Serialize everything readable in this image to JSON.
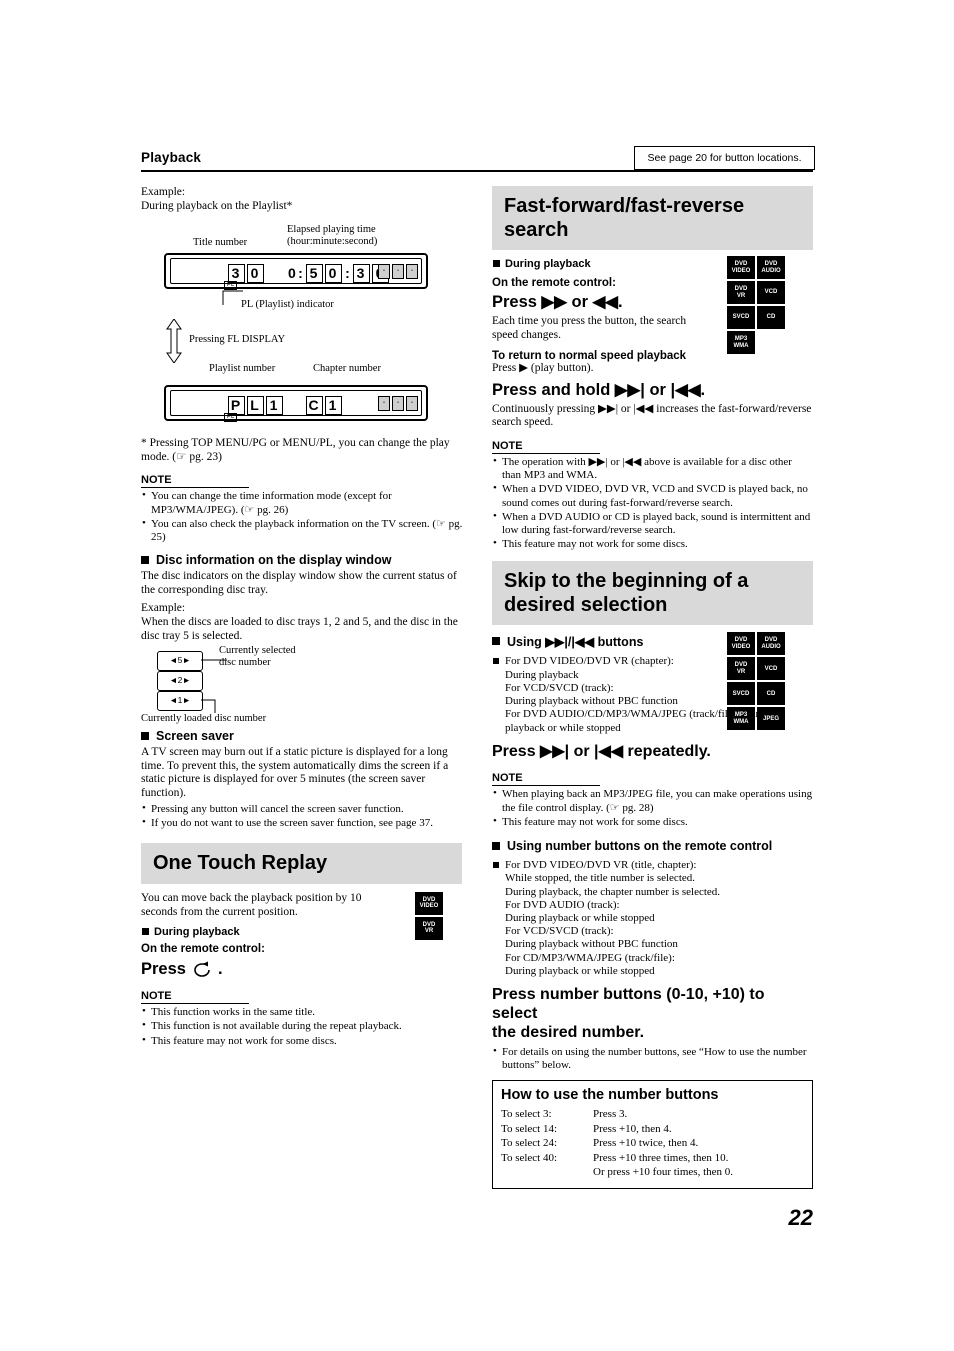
{
  "header": {
    "title": "Playback",
    "note_box": "See page 20 for button locations."
  },
  "left": {
    "example_label": "Example:",
    "example_line": "During playback on the Playlist*",
    "callout_title_number": "Title number",
    "callout_elapsed_1": "Elapsed playing time",
    "callout_elapsed_2": "(hour:minute:second)",
    "display1": {
      "d1": "3",
      "d2": "0",
      "t1": "0",
      "t2": ":",
      "t3": "5",
      "t4": "0",
      "t5": ":",
      "t6": "3",
      "t7": "0",
      "sub": "PL"
    },
    "callout_pl": "PL (Playlist) indicator",
    "callout_pressing": "Pressing FL DISPLAY",
    "callout_playlist_number": "Playlist number",
    "callout_chapter_number": "Chapter number",
    "display2": {
      "p": "P",
      "l": "L",
      "n1": "1",
      "c": "C",
      "n2": "1",
      "sub": "PL"
    },
    "footnote": "*  Pressing TOP MENU/PG or MENU/PL, you can change the play mode. (☞ pg. 23)",
    "note_label": "NOTE",
    "notes": [
      "You can change the time information mode (except for MP3/WMA/JPEG). (☞ pg. 26)",
      "You can also check the playback information on the TV screen. (☞ pg. 25)"
    ],
    "disc_info_heading": "Disc information on the display window",
    "disc_info_body": "The disc indicators on the display window show the current status of the corresponding disc tray.",
    "disc_example_label": "Example:",
    "disc_example_body": "When the discs are loaded to disc trays 1, 2 and 5, and the disc in the disc tray 5 is selected.",
    "tray_items": [
      "5",
      "2",
      "1"
    ],
    "callout_currently_selected_1": "Currently selected",
    "callout_currently_selected_2": "disc number",
    "callout_currently_loaded": "Currently loaded disc number",
    "screen_saver_heading": "Screen saver",
    "screen_saver_body": "A TV screen may burn out if a static picture is displayed for a long time. To prevent this, the system automatically dims the screen if a static picture is displayed for over 5 minutes (the screen saver function).",
    "screen_saver_notes": [
      "Pressing any button will cancel the screen saver function.",
      "If you do not want to use the screen saver function, see page 37."
    ],
    "one_touch_title": "One Touch Replay",
    "one_touch_body": "You can move back the playback position by 10 seconds from the current position.",
    "one_touch_chips": [
      {
        "l1": "DVD",
        "l2": "VIDEO"
      },
      {
        "l1": "DVD",
        "l2": "VR"
      }
    ],
    "during_playback": "During playback",
    "on_remote": "On the remote control:",
    "press_label": "Press",
    "press_icon": "replay-10-icon",
    "one_touch_note_label": "NOTE",
    "one_touch_notes": [
      "This function works in the same title.",
      "This function is not available during the repeat playback.",
      "This feature may not work for some discs."
    ]
  },
  "right": {
    "ff_title_line1": "Fast-forward/fast-reverse",
    "ff_title_line2": "search",
    "ff_during": "During playback",
    "ff_chips": [
      {
        "l1": "DVD",
        "l2": "VIDEO"
      },
      {
        "l1": "DVD",
        "l2": "AUDIO"
      },
      {
        "l1": "DVD",
        "l2": "VR"
      },
      {
        "l1": "VCD",
        "l2": ""
      },
      {
        "l1": "SVCD",
        "l2": ""
      },
      {
        "l1": "CD",
        "l2": ""
      },
      {
        "l1": "MP3",
        "l2": "WMA"
      }
    ],
    "ff_on_remote": "On the remote control:",
    "ff_press": "Press ▶▶ or ◀◀.",
    "ff_press_body": "Each time you press the button, the search speed changes.",
    "ff_return_head": "To return to normal speed playback",
    "ff_return_body": "Press ▶ (play button).",
    "ff_press_hold": "Press and hold ▶▶| or |◀◀.",
    "ff_press_hold_body": "Continuously pressing ▶▶| or |◀◀ increases the fast-forward/reverse search speed.",
    "ff_note_label": "NOTE",
    "ff_notes": [
      "The operation with ▶▶| or |◀◀ above is available for a disc other than MP3 and WMA.",
      "When a DVD VIDEO, DVD VR, VCD and SVCD is played back, no sound comes out during fast-forward/reverse search.",
      "When a DVD AUDIO or CD is played back, sound is intermittent and low during fast-forward/reverse search.",
      "This feature may not work for some discs."
    ],
    "skip_title_line1": "Skip to the beginning of a",
    "skip_title_line2": "desired selection",
    "skip_using_head": "Using ▶▶|/|◀◀ buttons",
    "skip_chips": [
      {
        "l1": "DVD",
        "l2": "VIDEO"
      },
      {
        "l1": "DVD",
        "l2": "AUDIO"
      },
      {
        "l1": "DVD",
        "l2": "VR"
      },
      {
        "l1": "VCD",
        "l2": ""
      },
      {
        "l1": "SVCD",
        "l2": ""
      },
      {
        "l1": "CD",
        "l2": ""
      },
      {
        "l1": "MP3",
        "l2": "WMA"
      },
      {
        "l1": "JPEG",
        "l2": ""
      }
    ],
    "skip_item1": "For DVD VIDEO/DVD VR (chapter):",
    "skip_item1_sub": "During playback",
    "skip_item2": "For VCD/SVCD (track):",
    "skip_item2_sub": "During playback without PBC function",
    "skip_item3": "For DVD AUDIO/CD/MP3/WMA/JPEG (track/file): During playback or while stopped",
    "skip_press": "Press ▶▶| or |◀◀ repeatedly.",
    "skip_note_label": "NOTE",
    "skip_notes": [
      "When playing back an MP3/JPEG file, you can make operations using the file control display. (☞ pg. 28)",
      "This feature may not work for some discs."
    ],
    "num_head": "Using number buttons on the remote control",
    "num_item1": "For DVD VIDEO/DVD VR (title, chapter):",
    "num_item1_a": "While stopped, the title number is selected.",
    "num_item1_b": "During playback, the chapter number is selected.",
    "num_item2": "For DVD AUDIO (track):",
    "num_item2_a": "During playback or while stopped",
    "num_item3": "For VCD/SVCD (track):",
    "num_item3_a": "During playback without PBC function",
    "num_item4": "For CD/MP3/WMA/JPEG (track/file):",
    "num_item4_a": "During playback or while stopped",
    "num_press_1": "Press number buttons (0-10, +10) to select",
    "num_press_2": "the desired number.",
    "num_bullet": "For details on using the number buttons, see “How to use the number buttons” below.",
    "howto_title": "How to use the number buttons",
    "howto_rows": [
      {
        "k": "To select 3:",
        "v": "Press 3."
      },
      {
        "k": "To select 14:",
        "v": "Press +10, then 4."
      },
      {
        "k": "To select 24:",
        "v": "Press +10 twice, then 4."
      },
      {
        "k": "To select 40:",
        "v": "Press +10 three times, then 10."
      },
      {
        "k": "",
        "v": "Or press +10 four times, then 0."
      }
    ]
  },
  "footer": {
    "page_number": "22"
  }
}
